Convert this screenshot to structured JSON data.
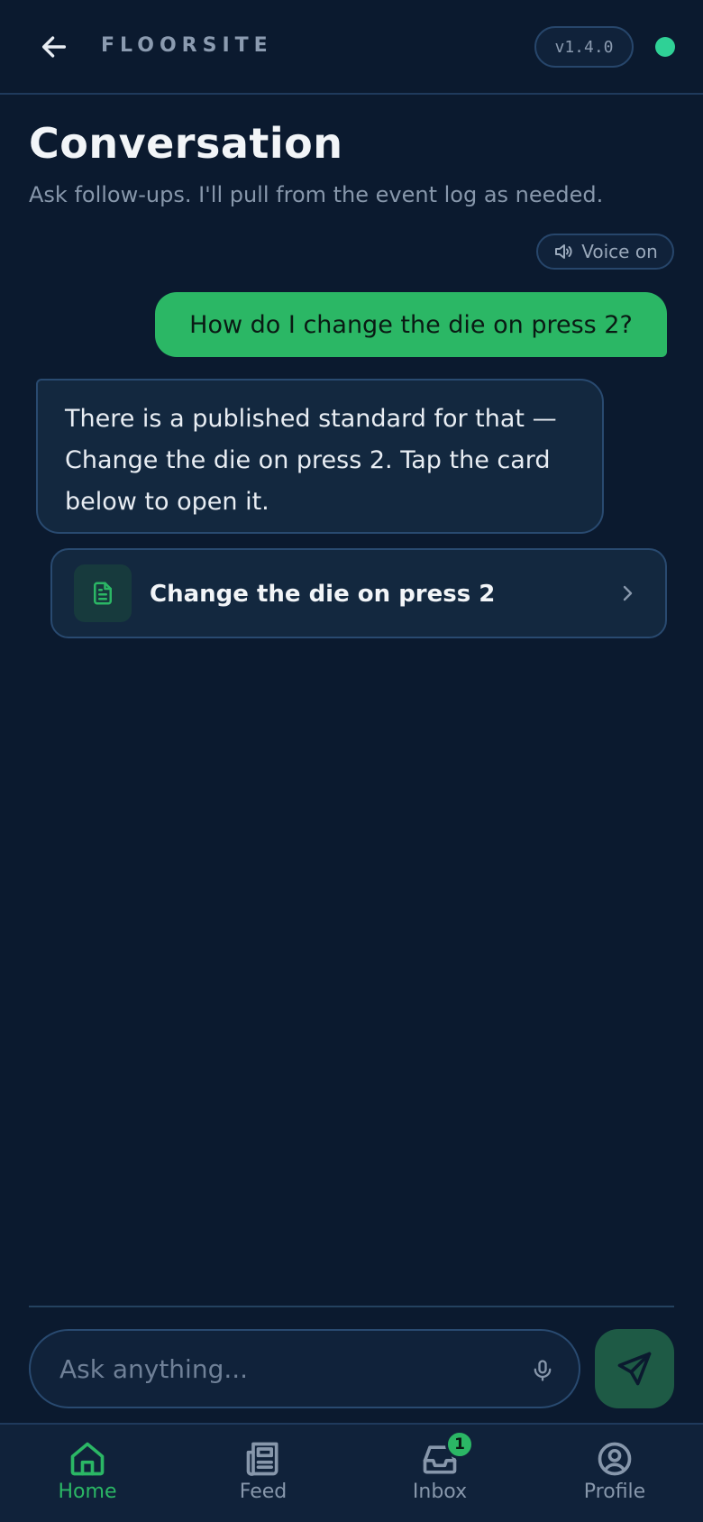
{
  "header": {
    "brand": "FLOORSITE",
    "version": "v1.4.0"
  },
  "page": {
    "title": "Conversation",
    "subtitle": "Ask follow-ups. I'll pull from the event log as needed.",
    "voice_toggle": "Voice on"
  },
  "messages": {
    "user": "How do I change the die on press 2?",
    "assistant": "There is a published standard for that — Change the die on press 2. Tap the card below to open it."
  },
  "doc_card": {
    "title": "Change the die on press 2"
  },
  "composer": {
    "placeholder": "Ask anything..."
  },
  "nav": {
    "items": [
      {
        "label": "Home"
      },
      {
        "label": "Feed"
      },
      {
        "label": "Inbox",
        "badge": "1"
      },
      {
        "label": "Profile"
      }
    ]
  },
  "colors": {
    "background": "#0b1a2f",
    "accent_green": "#2bb765",
    "status_dot": "#2fd196"
  }
}
